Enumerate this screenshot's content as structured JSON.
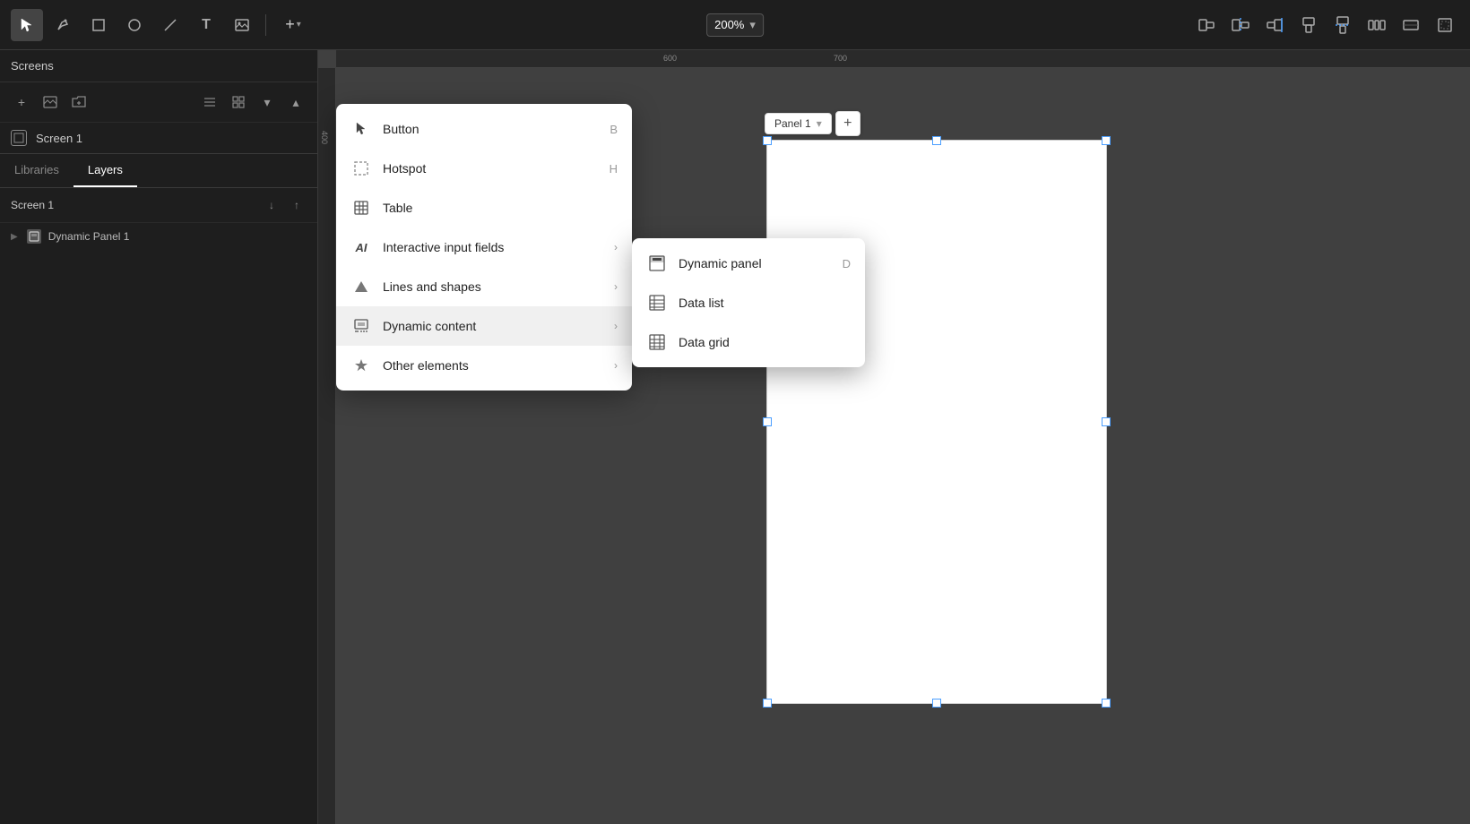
{
  "toolbar": {
    "zoom_label": "200%",
    "tools": [
      {
        "name": "select-tool",
        "symbol": "▲",
        "active": true
      },
      {
        "name": "pen-tool",
        "symbol": "✒"
      },
      {
        "name": "rect-tool",
        "symbol": "□"
      },
      {
        "name": "circle-tool",
        "symbol": "○"
      },
      {
        "name": "line-tool",
        "symbol": "/"
      },
      {
        "name": "text-tool",
        "symbol": "T"
      },
      {
        "name": "image-tool",
        "symbol": "⬜"
      }
    ],
    "add_button": "+",
    "right_icons": [
      "⊟",
      "⊞",
      "⊠",
      "⊡",
      "⊢",
      "⊣",
      "⊤",
      "⊥"
    ]
  },
  "screens_panel": {
    "title": "Screens",
    "screen_items": [
      {
        "name": "Screen 1",
        "id": "screen-1"
      }
    ]
  },
  "layers_panel": {
    "tabs": [
      "Libraries",
      "Layers"
    ],
    "active_tab": "Layers",
    "header_screen": "Screen 1",
    "items": [
      {
        "name": "Dynamic Panel 1",
        "type": "dynamic-panel",
        "expanded": false
      }
    ]
  },
  "canvas": {
    "panel_label": "Panel 1",
    "ruler_marks": [
      "600",
      "700"
    ]
  },
  "main_menu": {
    "items": [
      {
        "id": "button",
        "label": "Button",
        "shortcut": "B",
        "icon": "cursor"
      },
      {
        "id": "hotspot",
        "label": "Hotspot",
        "shortcut": "H",
        "icon": "hotspot"
      },
      {
        "id": "table",
        "label": "Table",
        "shortcut": "",
        "icon": "table"
      },
      {
        "id": "interactive-input",
        "label": "Interactive input fields",
        "shortcut": "",
        "icon": "ai",
        "has_submenu": true
      },
      {
        "id": "lines-shapes",
        "label": "Lines and shapes",
        "shortcut": "",
        "icon": "triangle",
        "has_submenu": true
      },
      {
        "id": "dynamic-content",
        "label": "Dynamic content",
        "shortcut": "",
        "icon": "dynamic",
        "has_submenu": true,
        "active": true
      },
      {
        "id": "other-elements",
        "label": "Other elements",
        "shortcut": "",
        "icon": "star",
        "has_submenu": true
      }
    ]
  },
  "submenu": {
    "title": "Dynamic content",
    "items": [
      {
        "id": "dynamic-panel",
        "label": "Dynamic panel",
        "shortcut": "D",
        "icon": "dynamic-panel"
      },
      {
        "id": "data-list",
        "label": "Data list",
        "shortcut": "",
        "icon": "data-list"
      },
      {
        "id": "data-grid",
        "label": "Data grid",
        "shortcut": "",
        "icon": "data-grid"
      }
    ]
  }
}
